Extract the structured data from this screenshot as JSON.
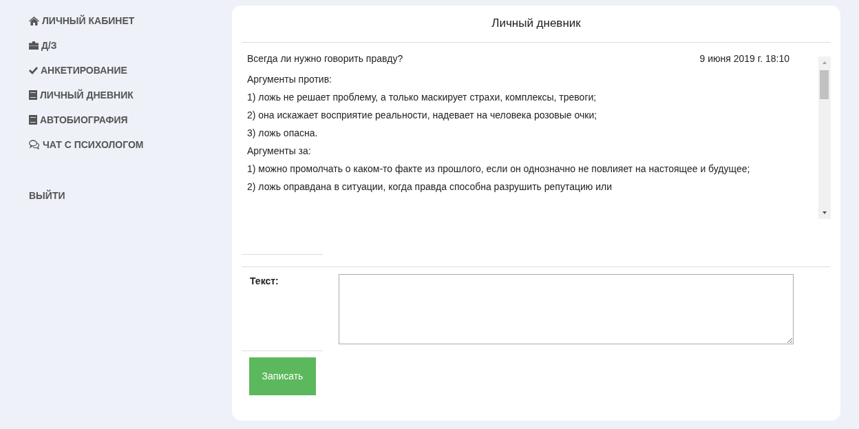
{
  "sidebar": {
    "items": [
      {
        "kind": "home",
        "label": "ЛИЧНЫЙ КАБИНЕТ"
      },
      {
        "kind": "briefcase",
        "label": "Д/З"
      },
      {
        "kind": "check",
        "label": "АНКЕТИРОВАНИЕ"
      },
      {
        "kind": "book",
        "label": "ЛИЧНЫЙ ДНЕВНИК"
      },
      {
        "kind": "book",
        "label": "АВТОБИОГРАФИЯ"
      },
      {
        "kind": "chat",
        "label": "ЧАТ С ПСИХОЛОГОМ"
      }
    ],
    "logout": "ВЫЙТИ"
  },
  "diary": {
    "title": "Личный дневник",
    "entry": {
      "title": "Всегда ли нужно говорить правду?",
      "date": "9 июня 2019 г. 18:10",
      "lines": [
        "Аргументы против:",
        "1)  ложь не решает проблему, а только маскирует страхи,  комплексы, тревоги;",
        "2)  она искажает восприятие  реальности, надевает на человека розовые очки;",
        "3)  ложь опасна.",
        "Аргументы за:",
        "1) можно промолчать о каком-то  факте из прошлого, если он однозначно не повлияет на настоящее и будущее;",
        "2) ложь оправдана в ситуации,  когда правда способна разрушить репутацию или"
      ]
    },
    "form": {
      "label": "Текст:",
      "button": "Записать"
    }
  }
}
